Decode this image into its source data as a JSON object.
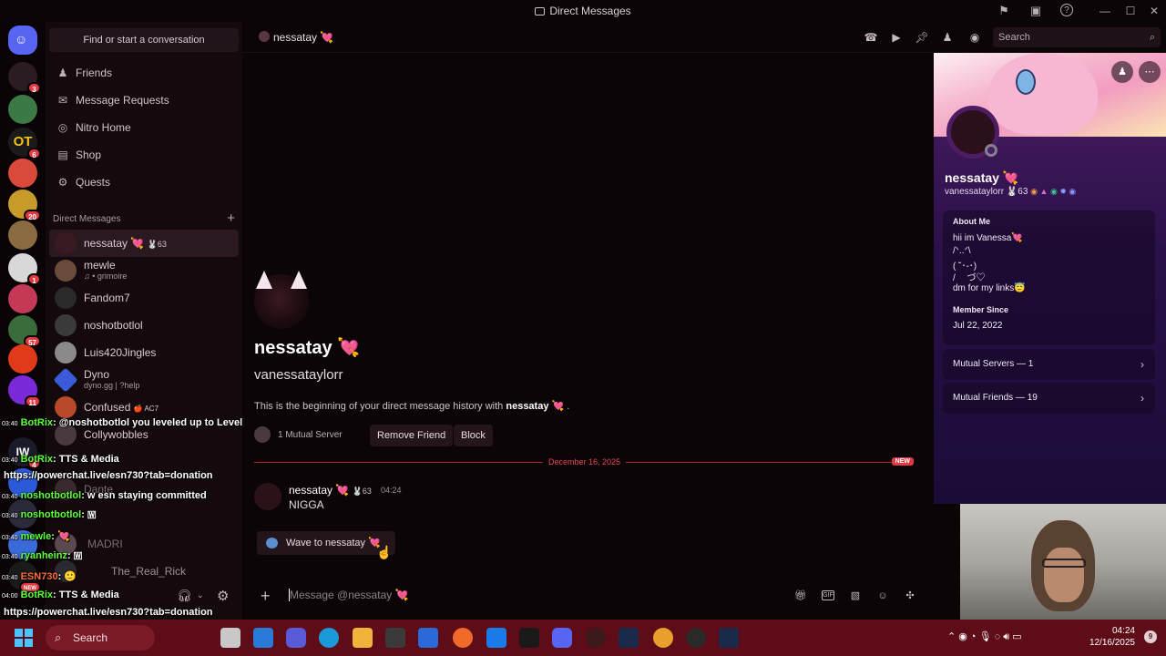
{
  "window": {
    "title": "Direct Messages"
  },
  "rail": {
    "badges": [
      "3",
      "6",
      "20",
      "1",
      "57",
      "11",
      "4",
      "NEW"
    ]
  },
  "sidebar": {
    "find_placeholder": "Find or start a conversation",
    "nav": [
      {
        "label": "Friends",
        "icon": "friends-icon"
      },
      {
        "label": "Message Requests",
        "icon": "envelope-icon"
      },
      {
        "label": "Nitro Home",
        "icon": "nitro-icon"
      },
      {
        "label": "Shop",
        "icon": "shop-icon"
      },
      {
        "label": "Quests",
        "icon": "quests-icon"
      }
    ],
    "dm_header": "Direct Messages",
    "dms": [
      {
        "name": "nessatay 💘",
        "tag": "🐰63",
        "active": true
      },
      {
        "name": "mewle",
        "sub": "♫ • grimoire"
      },
      {
        "name": "Fandom7"
      },
      {
        "name": "noshotbotlol"
      },
      {
        "name": "Luis420Jingles"
      },
      {
        "name": "Dyno",
        "sub": "dyno.gg | ?help"
      },
      {
        "name": "Confused",
        "tag": "🍎 AC7"
      },
      {
        "name": "Collywobbles"
      },
      {
        "name": "Dante"
      },
      {
        "name": "MADRI"
      },
      {
        "name": "The_Real_Rick"
      }
    ]
  },
  "overlay": {
    "lines": [
      {
        "time": "03:40",
        "nick": "BotRix",
        "text": ": @noshotbotlol you leveled up to Level"
      },
      {
        "time": "03:40",
        "nick": "BotRix",
        "text": ": TTS & Media"
      },
      {
        "time": "",
        "nick": "",
        "text": "https://powerchat.live/esn730?tab=donation"
      },
      {
        "time": "03:40",
        "nick": "noshotbotlol",
        "text": ": w esn staying committed"
      },
      {
        "time": "03:40",
        "nick": "noshotbotlol",
        "text": ": 🇼"
      },
      {
        "time": "03:40",
        "nick": "mewle",
        "text": ": 💘"
      },
      {
        "time": "03:40",
        "nick": "ryanheinz",
        "text": ": 🇼"
      },
      {
        "time": "03:40",
        "nick": "ESN730",
        "text": ": 🙂"
      },
      {
        "time": "04:00",
        "nick": "BotRix",
        "text": ": TTS & Media"
      },
      {
        "time": "",
        "nick": "",
        "text": "https://powerchat.live/esn730?tab=donation"
      }
    ]
  },
  "header": {
    "name": "nessatay 💘",
    "search_placeholder": "Search"
  },
  "chat": {
    "big_name": "nessatay 💘",
    "big_username": "vanessataylorr",
    "begin_prefix": "This is the beginning of your direct message history with ",
    "begin_name": "nessatay 💘",
    "begin_suffix": ".",
    "mutual": "1 Mutual Server",
    "remove_friend": "Remove Friend",
    "block": "Block",
    "divider_date": "December 16, 2025",
    "new_tag": "NEW",
    "message": {
      "author": "nessatay 💘",
      "tag": "🐰63",
      "time": "04:24",
      "text": "NIGGA"
    },
    "wave_label": "Wave to nessatay 💘",
    "composer_placeholder": "Message @nessatay 💘"
  },
  "profile": {
    "name": "nessatay 💘",
    "username": "vanessataylorr",
    "tag": "🐰63",
    "about_label": "About Me",
    "bio": [
      "hii im Vanessa💘",
      "/ᐠ..ᐟ\\",
      "( ˘･-･)",
      "/ 　づ♡",
      "dm for my links😇"
    ],
    "member_since_label": "Member Since",
    "member_since": "Jul 22, 2022",
    "mutual_servers": "Mutual Servers — 1",
    "mutual_friends": "Mutual Friends — 19"
  },
  "taskbar": {
    "search": "Search",
    "time": "04:24",
    "date": "12/16/2025"
  }
}
